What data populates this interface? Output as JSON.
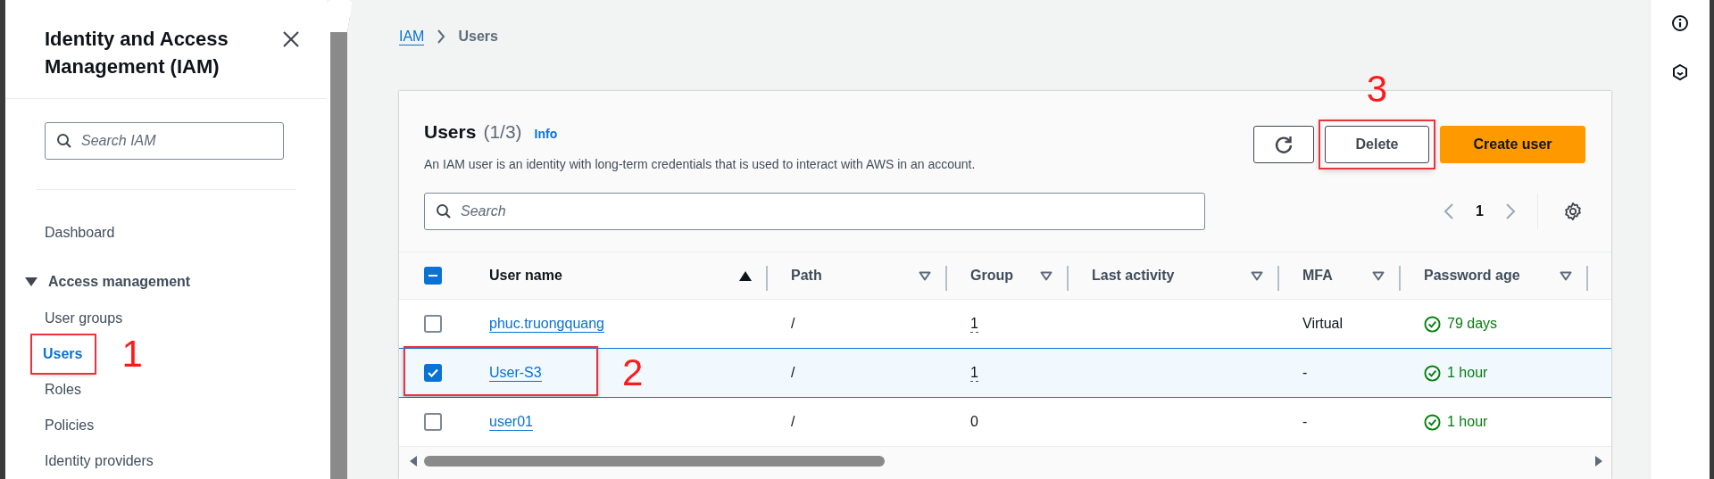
{
  "sidebar": {
    "title": "Identity and Access Management (IAM)",
    "search": {
      "placeholder": "Search IAM"
    },
    "items": [
      {
        "kind": "link",
        "label": "Dashboard",
        "selected": false
      },
      {
        "kind": "section",
        "label": "Access management",
        "expanded": true,
        "children": [
          {
            "label": "User groups",
            "selected": false
          },
          {
            "label": "Users",
            "selected": true,
            "annotation": "1"
          },
          {
            "label": "Roles",
            "selected": false
          },
          {
            "label": "Policies",
            "selected": false
          },
          {
            "label": "Identity providers",
            "selected": false
          }
        ]
      }
    ]
  },
  "breadcrumb": [
    {
      "kind": "link",
      "label": "IAM"
    },
    {
      "kind": "current",
      "label": "Users"
    }
  ],
  "panel": {
    "title": "Users",
    "count": "(1/3)",
    "info": "Info",
    "description": "An IAM user is an identity with long-term credentials that is used to interact with AWS in an account.",
    "buttons": [
      {
        "kind": "refresh"
      },
      {
        "kind": "normal",
        "label": "Delete",
        "annotation": "3"
      },
      {
        "kind": "primary",
        "label": "Create user"
      }
    ],
    "search": {
      "placeholder": "Search"
    },
    "pagination": {
      "page": "1"
    },
    "table": {
      "header_indeterminate": true,
      "columns": [
        {
          "label": "User name",
          "sorted": true
        },
        {
          "label": "Path",
          "sorted": false
        },
        {
          "label": "Group",
          "sorted": false
        },
        {
          "label": "Last activity",
          "sorted": false
        },
        {
          "label": "MFA",
          "sorted": false
        },
        {
          "label": "Password age",
          "sorted": false
        }
      ],
      "rows": [
        {
          "selected": false,
          "user_name": "phuc.truongquang",
          "path": "/",
          "groups": "1",
          "groups_underlined": true,
          "mfa": "Virtual",
          "password_age": "79 days"
        },
        {
          "selected": true,
          "user_name": "User-S3",
          "path": "/",
          "groups": "1",
          "groups_underlined": true,
          "mfa": "-",
          "password_age": "1 hour",
          "annotation": "2"
        },
        {
          "selected": false,
          "user_name": "user01",
          "path": "/",
          "groups": "0",
          "groups_underlined": false,
          "mfa": "-",
          "password_age": "1 hour"
        }
      ]
    }
  }
}
